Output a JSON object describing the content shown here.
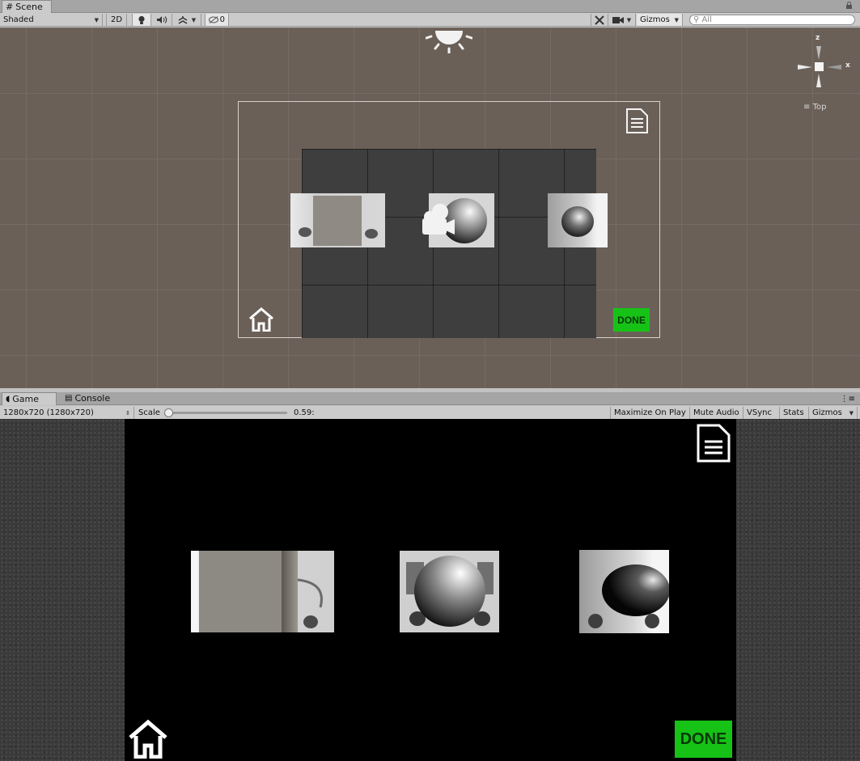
{
  "scene_tab": {
    "label": "Scene"
  },
  "scene_toolbar": {
    "shading_mode": "Shaded",
    "mode_2d": "2D",
    "hidden_count": "0",
    "gizmos_label": "Gizmos",
    "search_placeholder": "All"
  },
  "scene_gizmo": {
    "y_axis": "z",
    "x_axis": "x",
    "view_label": "Top"
  },
  "scene_ui": {
    "done_label": "DONE"
  },
  "bottom_tabs": {
    "game": "Game",
    "console": "Console"
  },
  "game_toolbar": {
    "resolution": "1280x720 (1280x720)",
    "scale_label": "Scale",
    "scale_value": "0.59:",
    "maximize_on_play": "Maximize On Play",
    "mute_audio": "Mute Audio",
    "vsync": "VSync",
    "stats": "Stats",
    "gizmos_label": "Gizmos"
  },
  "game_ui": {
    "done_label": "DONE"
  },
  "colors": {
    "scene_bg": "#6b6058",
    "done_green": "#17c217",
    "editor_chrome": "#cbcbcb"
  }
}
